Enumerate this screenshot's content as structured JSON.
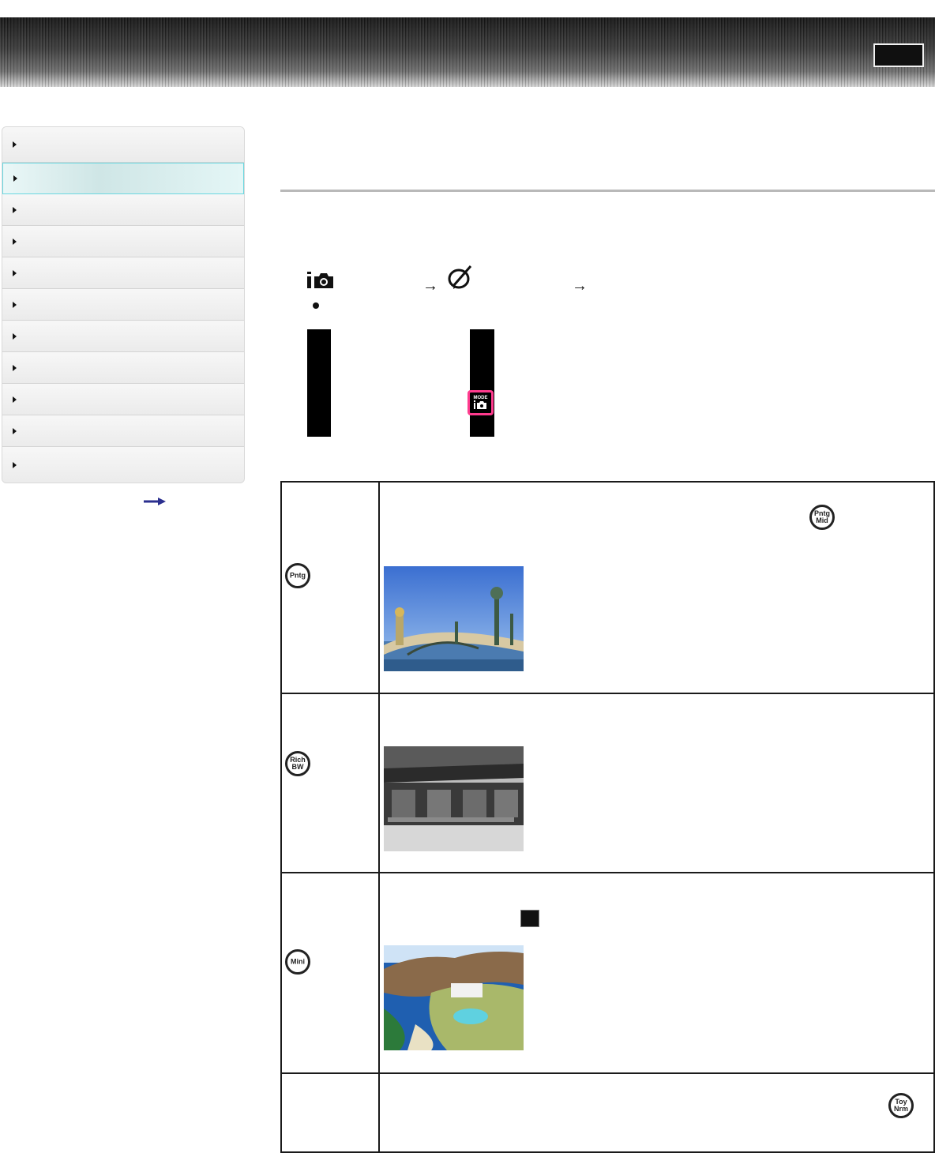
{
  "header": {
    "title": "",
    "button_label": ""
  },
  "sidebar": {
    "items": [
      {
        "label": ""
      },
      {
        "label": ""
      },
      {
        "label": ""
      },
      {
        "label": ""
      },
      {
        "label": ""
      },
      {
        "label": ""
      },
      {
        "label": ""
      },
      {
        "label": ""
      },
      {
        "label": ""
      },
      {
        "label": ""
      },
      {
        "label": ""
      }
    ],
    "active_index": 1,
    "more_link_icon": "right-arrow-icon"
  },
  "path": {
    "icons": [
      "camera-mode-icon",
      "picture-effect-icon"
    ],
    "arrow": "→"
  },
  "screen": {
    "badge_text": "MODE",
    "accent": "#ff3b8e"
  },
  "effects": [
    {
      "icon_text": "Pntg",
      "inline_badge_text": "Pntg\nMid",
      "photo": "bridge"
    },
    {
      "icon_text": "Rich\nBW",
      "photo": "cafe"
    },
    {
      "icon_text": "Mini",
      "photo": "coast"
    },
    {
      "icon_text": "",
      "inline_badge_text": "Toy\nNrm"
    }
  ]
}
